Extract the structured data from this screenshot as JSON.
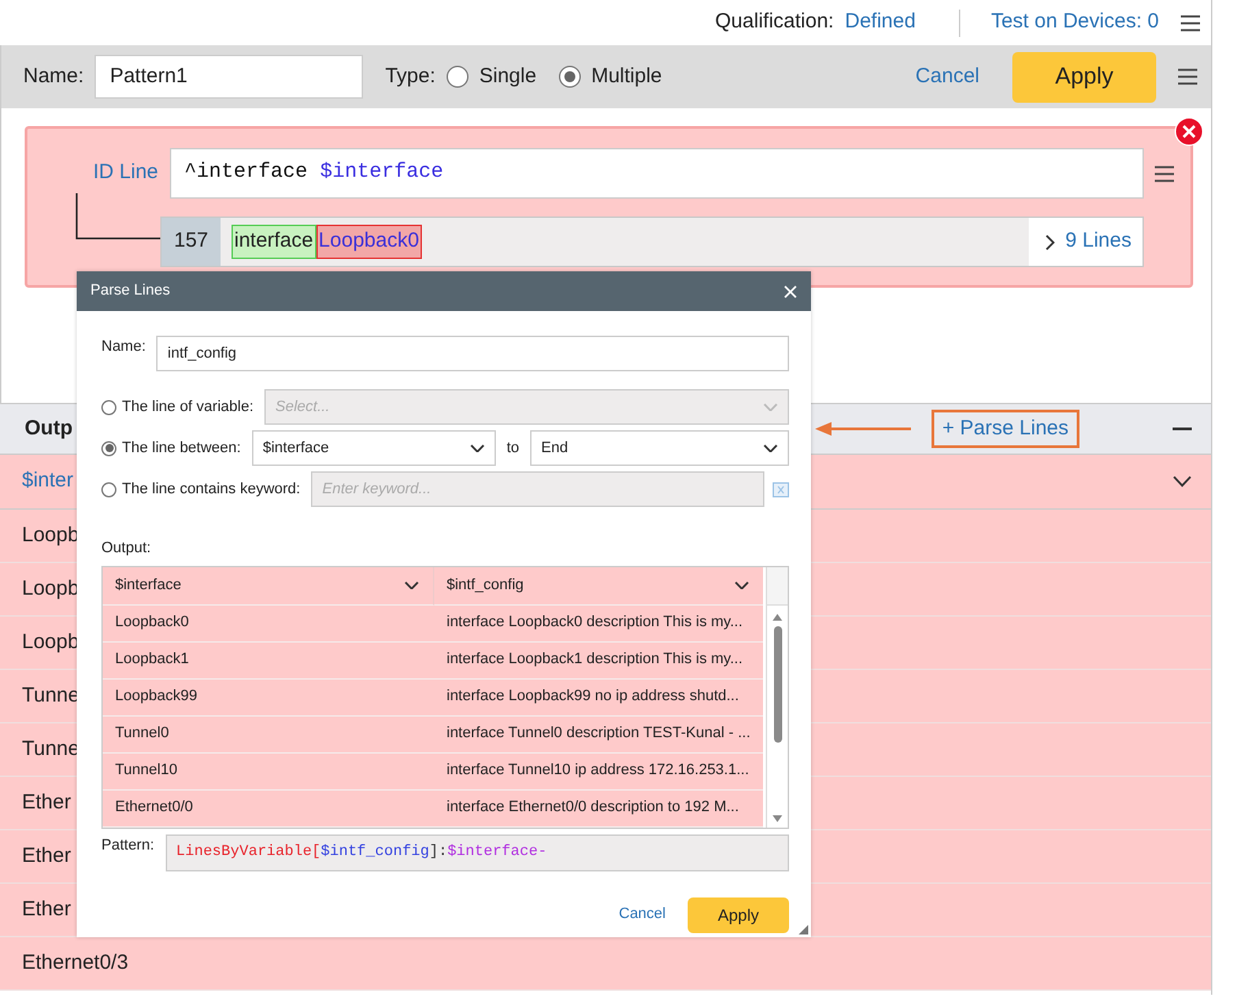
{
  "top_bar": {
    "qualification_label": "Qualification:",
    "qualification_value": "Defined",
    "test_devices": "Test on Devices: 0"
  },
  "header": {
    "name_label": "Name:",
    "name_value": "Pattern1",
    "type_label": "Type:",
    "type_options": [
      {
        "label": "Single",
        "selected": false
      },
      {
        "label": "Multiple",
        "selected": true
      }
    ],
    "cancel": "Cancel",
    "apply": "Apply"
  },
  "id_line": {
    "label": "ID Line",
    "pattern_parts": [
      {
        "text": "^interface ",
        "kind": "literal"
      },
      {
        "text": "$interface",
        "kind": "variable"
      }
    ],
    "line_number": "157",
    "matches": [
      {
        "text": "interface",
        "kind": "literal"
      },
      {
        "text": "Loopback0",
        "kind": "variable"
      }
    ],
    "lines_link": "9 Lines"
  },
  "output": {
    "title": "Outp",
    "parse_lines": "+ Parse Lines",
    "column_header": "$inter",
    "rows": [
      "Loopb",
      "Loopb",
      "Loopb",
      "Tunne",
      "Tunne",
      "Ether",
      "Ether",
      "Ether",
      "Ethernet0/3"
    ]
  },
  "dialog": {
    "title": "Parse Lines",
    "name_label": "Name:",
    "name_value": "intf_config",
    "options": [
      {
        "label": "The line of variable:",
        "selected": false,
        "kind": "select",
        "placeholder": "Select...",
        "disabled": true
      },
      {
        "label": "The line between:",
        "selected": true,
        "kind": "range",
        "from": "$interface",
        "connector": "to",
        "to": "End",
        "disabled": false
      },
      {
        "label": "The line contains keyword:",
        "selected": false,
        "kind": "keyword",
        "placeholder": "Enter keyword...",
        "disabled": true
      }
    ],
    "output_label": "Output:",
    "columns": [
      "$interface",
      "$intf_config"
    ],
    "rows": [
      [
        "Loopback0",
        "interface Loopback0 description This is my..."
      ],
      [
        "Loopback1",
        "interface Loopback1 description This is my..."
      ],
      [
        "Loopback99",
        "interface Loopback99 no ip address shutd..."
      ],
      [
        "Tunnel0",
        "interface Tunnel0 description TEST-Kunal - ..."
      ],
      [
        "Tunnel10",
        "interface Tunnel10 ip address 172.16.253.1..."
      ],
      [
        "Ethernet0/0",
        "interface Ethernet0/0 description to 192 M..."
      ]
    ],
    "pattern_label": "Pattern:",
    "pattern_parts": [
      {
        "text": "LinesByVariable[",
        "kind": "function"
      },
      {
        "text": "$intf_config",
        "kind": "variable"
      },
      {
        "text": "]:",
        "kind": "plain"
      },
      {
        "text": "$interface-",
        "kind": "reference"
      }
    ],
    "cancel": "Cancel",
    "apply": "Apply"
  }
}
